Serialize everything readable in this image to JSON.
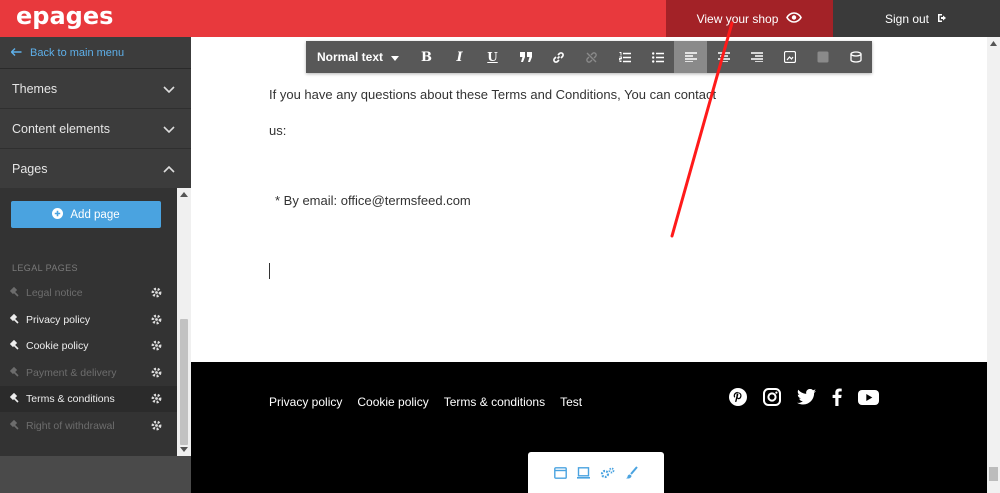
{
  "brand": {
    "logo": "epages"
  },
  "header": {
    "view_shop_label": "View your shop",
    "sign_out_label": "Sign out"
  },
  "sidebar": {
    "back_label": "Back to main menu",
    "sections": [
      {
        "label": "Themes",
        "state": "collapsed"
      },
      {
        "label": "Content elements",
        "state": "collapsed"
      },
      {
        "label": "Pages",
        "state": "expanded"
      }
    ],
    "add_page_label": "Add page",
    "legal_heading": "LEGAL PAGES",
    "legal_pages": [
      {
        "label": "Legal notice",
        "dimmed": true
      },
      {
        "label": "Privacy policy",
        "dimmed": false
      },
      {
        "label": "Cookie policy",
        "dimmed": false
      },
      {
        "label": "Payment & delivery",
        "dimmed": true
      },
      {
        "label": "Terms & conditions",
        "dimmed": false,
        "active": true
      },
      {
        "label": "Right of withdrawal",
        "dimmed": true
      }
    ]
  },
  "toolbar": {
    "format_label": "Normal text",
    "buttons": [
      "bold-icon",
      "italic-icon",
      "underline-icon",
      "quote-icon",
      "link-icon",
      "unlink-icon",
      "ordered-list-icon",
      "bullet-list-icon",
      "align-left-icon",
      "align-center-icon",
      "align-right-icon",
      "image-icon",
      "image-disabled-icon",
      "source-icon"
    ]
  },
  "content": {
    "line1": "If you have any questions about these Terms and Conditions, You can contact",
    "line2": "us:",
    "line3": "* By email: office@termsfeed.com"
  },
  "footer": {
    "links": [
      "Privacy policy",
      "Cookie policy",
      "Terms & conditions",
      "Test"
    ],
    "social": [
      "pinterest-icon",
      "instagram-icon",
      "twitter-icon",
      "facebook-icon",
      "youtube-icon"
    ]
  },
  "colors": {
    "brand_red": "#e8393d",
    "view_shop_bg": "#a32227",
    "accent_blue": "#4aa3e0",
    "sidebar_bg": "#3c3c3c"
  }
}
